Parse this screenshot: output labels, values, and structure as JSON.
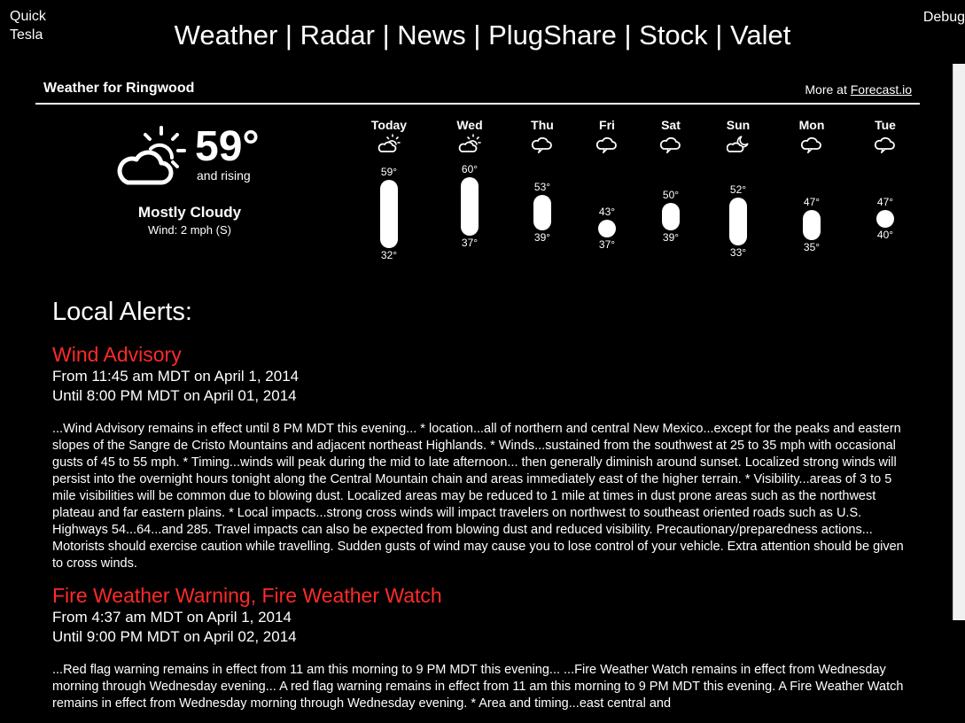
{
  "corner": {
    "quick_line1": "Quick",
    "quick_line2": "Tesla",
    "debug": "Debug"
  },
  "nav": {
    "items": [
      "Weather",
      "Radar",
      "News",
      "PlugShare",
      "Stock",
      "Valet"
    ],
    "separator": " | "
  },
  "weather": {
    "title": "Weather for Ringwood",
    "more_prefix": "More at ",
    "more_link": "Forecast.io",
    "current": {
      "icon": "partly-cloudy-day-icon",
      "temp": "59°",
      "trend": "and rising",
      "summary": "Mostly Cloudy",
      "wind": "Wind: 2 mph (S)"
    },
    "daily": [
      {
        "day": "Today",
        "icon": "partly-cloudy-day-icon",
        "hi": "59°",
        "lo": "32°",
        "hi_val": 59,
        "lo_val": 32
      },
      {
        "day": "Wed",
        "icon": "partly-cloudy-day-icon",
        "hi": "60°",
        "lo": "37°",
        "hi_val": 60,
        "lo_val": 37
      },
      {
        "day": "Thu",
        "icon": "cloudy-icon",
        "hi": "53°",
        "lo": "39°",
        "hi_val": 53,
        "lo_val": 39
      },
      {
        "day": "Fri",
        "icon": "cloudy-icon",
        "hi": "43°",
        "lo": "37°",
        "hi_val": 43,
        "lo_val": 37
      },
      {
        "day": "Sat",
        "icon": "cloudy-icon",
        "hi": "50°",
        "lo": "39°",
        "hi_val": 50,
        "lo_val": 39
      },
      {
        "day": "Sun",
        "icon": "partly-cloudy-night-icon",
        "hi": "52°",
        "lo": "33°",
        "hi_val": 52,
        "lo_val": 33
      },
      {
        "day": "Mon",
        "icon": "cloudy-icon",
        "hi": "47°",
        "lo": "35°",
        "hi_val": 47,
        "lo_val": 35
      },
      {
        "day": "Tue",
        "icon": "cloudy-icon",
        "hi": "47°",
        "lo": "40°",
        "hi_val": 47,
        "lo_val": 40
      }
    ]
  },
  "alerts": {
    "heading": "Local Alerts:",
    "items": [
      {
        "title": "Wind Advisory",
        "from": "From 11:45 am MDT on April 1, 2014",
        "until": "Until 8:00 PM MDT on April 01, 2014",
        "body": "...Wind Advisory remains in effect until 8 PM MDT this evening... * location...all of northern and central New Mexico...except for the peaks and eastern slopes of the Sangre de Cristo Mountains and adjacent northeast Highlands. * Winds...sustained from the southwest at 25 to 35 mph with occasional gusts of 45 to 55 mph. * Timing...winds will peak during the mid to late afternoon... then generally diminish around sunset. Localized strong winds will persist into the overnight hours tonight along the Central Mountain chain and areas immediately east of the higher terrain. * Visibility...areas of 3 to 5 mile visibilities will be common due to blowing dust. Localized areas may be reduced to 1 mile at times in dust prone areas such as the northwest plateau and far eastern plains. * Local impacts...strong cross winds will impact travelers on northwest to southeast oriented roads such as U.S. Highways 54...64...and 285. Travel impacts can also be expected from blowing dust and reduced visibility. Precautionary/preparedness actions... Motorists should exercise caution while travelling. Sudden gusts of wind may cause you to lose control of your vehicle. Extra attention should be given to cross winds."
      },
      {
        "title": "Fire Weather Warning, Fire Weather Watch",
        "from": "From 4:37 am MDT on April 1, 2014",
        "until": "Until 9:00 PM MDT on April 02, 2014",
        "body": "...Red flag warning remains in effect from 11 am this morning to 9 PM MDT this evening... ...Fire Weather Watch remains in effect from Wednesday morning through Wednesday evening... A red flag warning remains in effect from 11 am this morning to 9 PM MDT this evening. A Fire Weather Watch remains in effect from Wednesday morning through Wednesday evening. * Area and timing...east central and"
      }
    ]
  }
}
